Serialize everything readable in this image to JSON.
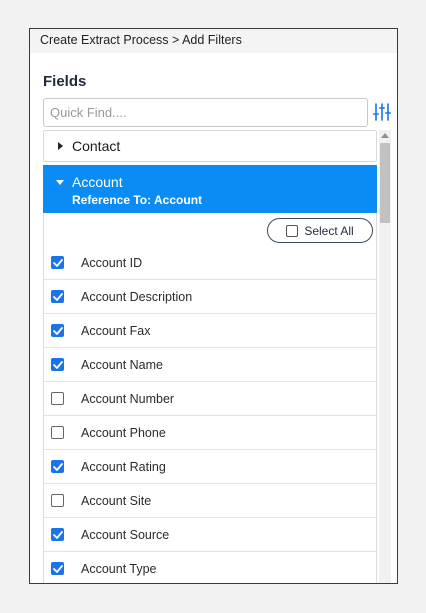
{
  "breadcrumb": "Create Extract Process > Add Filters",
  "fields_title": "Fields",
  "search": {
    "placeholder": "Quick Find...."
  },
  "icons": {
    "filter": "filter-sliders-icon",
    "expand": "caret-right-icon",
    "collapse": "caret-down-icon",
    "check": "checkmark-icon"
  },
  "colors": {
    "accent": "#0b8cf5",
    "checkbox": "#1a73e8"
  },
  "groups": {
    "contact": {
      "label": "Contact"
    },
    "account": {
      "label": "Account",
      "reference": "Reference To: Account"
    }
  },
  "select_all_label": "Select All",
  "fields": [
    {
      "label": "Account ID",
      "checked": true
    },
    {
      "label": "Account Description",
      "checked": true
    },
    {
      "label": "Account Fax",
      "checked": true
    },
    {
      "label": "Account Name",
      "checked": true
    },
    {
      "label": "Account Number",
      "checked": false
    },
    {
      "label": "Account Phone",
      "checked": false
    },
    {
      "label": "Account Rating",
      "checked": true
    },
    {
      "label": "Account Site",
      "checked": false
    },
    {
      "label": "Account Source",
      "checked": true
    },
    {
      "label": "Account Type",
      "checked": true
    }
  ]
}
